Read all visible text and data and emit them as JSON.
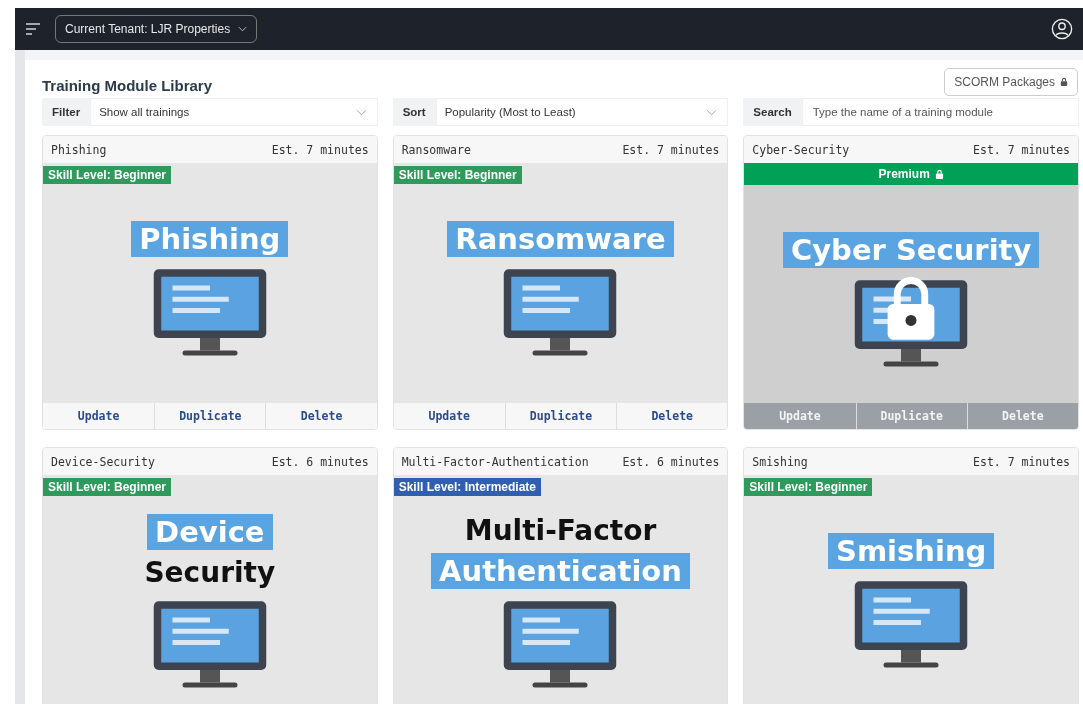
{
  "topbar": {
    "tenant": "Current Tenant: LJR Properties"
  },
  "page": {
    "title": "Training Module Library",
    "scorm_button": "SCORM Packages"
  },
  "controls": [
    {
      "kind": "select",
      "label": "Filter",
      "value": "Show all trainings"
    },
    {
      "kind": "select",
      "label": "Sort",
      "value": "Popularity (Most to Least)"
    },
    {
      "kind": "search",
      "label": "Search",
      "placeholder": "Type the name of a training module"
    }
  ],
  "cards": [
    {
      "title": "Phishing",
      "duration": "Est. 7 minutes",
      "badge": {
        "kind": "skill",
        "text": "Skill Level: Beginner",
        "color": "#2e9a5c"
      },
      "locked": false,
      "banner": [
        {
          "kind": "label",
          "text": "Phishing"
        }
      ],
      "buttons": [
        "Update",
        "Duplicate",
        "Delete"
      ]
    },
    {
      "title": "Ransomware",
      "duration": "Est. 7 minutes",
      "badge": {
        "kind": "skill",
        "text": "Skill Level: Beginner",
        "color": "#2e9a5c"
      },
      "locked": false,
      "banner": [
        {
          "kind": "label",
          "text": "Ransomware"
        }
      ],
      "buttons": [
        "Update",
        "Duplicate",
        "Delete"
      ]
    },
    {
      "title": "Cyber-Security",
      "duration": "Est. 7 minutes",
      "badge": {
        "kind": "premium",
        "text": "Premium",
        "color": "#00a056"
      },
      "locked": true,
      "banner": [
        {
          "kind": "label",
          "text": "Cyber Security"
        }
      ],
      "buttons": [
        "Update",
        "Duplicate",
        "Delete"
      ]
    },
    {
      "title": "Device-Security",
      "duration": "Est. 6 minutes",
      "badge": {
        "kind": "skill",
        "text": "Skill Level: Beginner",
        "color": "#2e9a5c"
      },
      "locked": false,
      "banner": [
        {
          "kind": "label",
          "text": "Device"
        },
        {
          "kind": "plain",
          "text": "Security"
        }
      ]
    },
    {
      "title": "Multi-Factor-Authentication",
      "duration": "Est. 6 minutes",
      "badge": {
        "kind": "skill",
        "text": "Skill Level: Intermediate",
        "color": "#2f5fae"
      },
      "locked": false,
      "banner": [
        {
          "kind": "plain",
          "text": "Multi-Factor"
        },
        {
          "kind": "label",
          "text": "Authentication"
        }
      ]
    },
    {
      "title": "Smishing",
      "duration": "Est. 7 minutes",
      "badge": {
        "kind": "skill",
        "text": "Skill Level: Beginner",
        "color": "#2e9a5c"
      },
      "locked": false,
      "banner": [
        {
          "kind": "label",
          "text": "Smishing"
        }
      ]
    }
  ]
}
